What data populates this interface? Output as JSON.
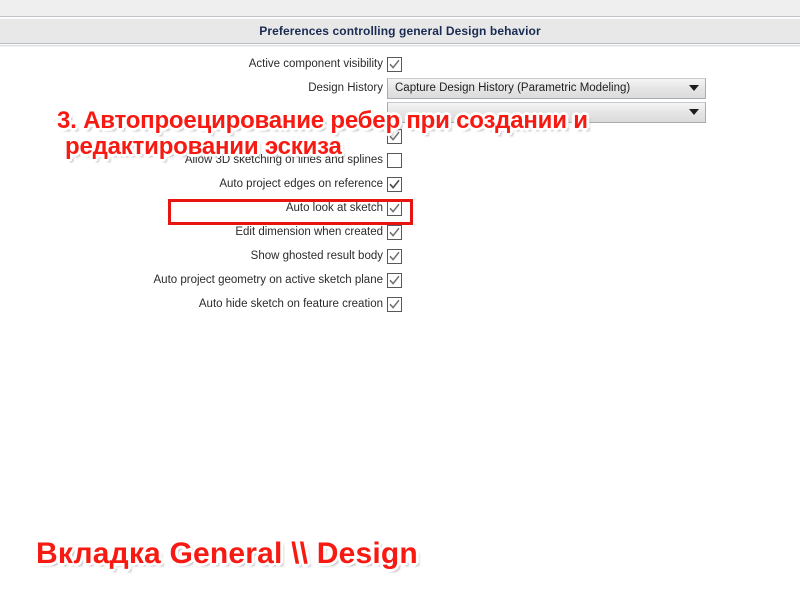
{
  "window": {
    "title": "Preferences controlling general Design behavior"
  },
  "colors": {
    "annotation_red": "#f61a12",
    "highlight_box_red": "#e8140f",
    "title_text": "#1a2b52",
    "titlebar_bg": "#e8e8e8"
  },
  "form": {
    "rows": [
      {
        "label": "Active component visibility",
        "control": "checkbox",
        "checked": true,
        "name": "active-component-visibility"
      },
      {
        "label": "Design History",
        "control": "dropdown",
        "value": "Capture Design History (Parametric Modeling)",
        "name": "design-history"
      },
      {
        "label": "",
        "control": "dropdown",
        "value": "",
        "name": "hidden-dropdown-row",
        "obscured_by_annotation": true
      },
      {
        "label": "",
        "control": "checkbox",
        "checked": true,
        "name": "obscured-checkbox-row",
        "obscured_by_annotation": true
      },
      {
        "label": "Allow 3D sketching of lines and splines",
        "control": "checkbox",
        "checked": false,
        "name": "allow-3d-sketching"
      },
      {
        "label": "Auto project edges on reference",
        "control": "checkbox",
        "checked": true,
        "name": "auto-project-edges-on-reference",
        "highlighted": true
      },
      {
        "label": "Auto look at sketch",
        "control": "checkbox",
        "checked": true,
        "name": "auto-look-at-sketch"
      },
      {
        "label": "Edit dimension when created",
        "control": "checkbox",
        "checked": true,
        "name": "edit-dimension-when-created"
      },
      {
        "label": "Show ghosted result body",
        "control": "checkbox",
        "checked": true,
        "name": "show-ghosted-result-body"
      },
      {
        "label": "Auto project geometry on active sketch plane",
        "control": "checkbox",
        "checked": true,
        "name": "auto-project-geometry-on-active-sketch-plane"
      },
      {
        "label": "Auto hide sketch on feature creation",
        "control": "checkbox",
        "checked": true,
        "name": "auto-hide-sketch-on-feature-creation"
      }
    ]
  },
  "annotations": {
    "top_line1": "3. Автопроецирование ребер при создании и",
    "top_line2": "редактировании эскиза",
    "bottom": "Вкладка General \\\\ Design"
  }
}
